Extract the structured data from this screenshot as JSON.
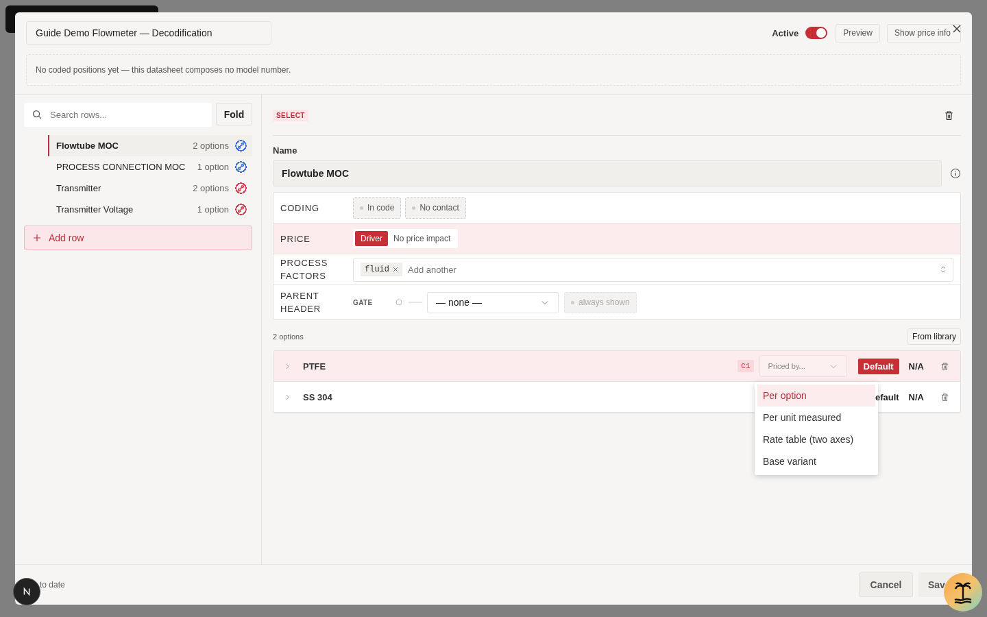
{
  "header": {
    "title": "Guide Demo Flowmeter — Decodification",
    "active": {
      "label": "Active",
      "on": true
    },
    "buttons": [
      "Preview",
      "Show price info"
    ]
  },
  "notice": "No coded positions yet — this datasheet composes no model number.",
  "sidebar": {
    "search": {
      "placeholder": "Search rows..."
    },
    "fold": "Fold",
    "rows": [
      {
        "name": "Flowtube MOC",
        "count": "2 options",
        "selected": true,
        "color": "#3b6fd1"
      },
      {
        "name": "PROCESS CONNECTION MOC",
        "count": "1 option",
        "selected": false,
        "color": "#3b6fd1"
      },
      {
        "name": "Transmitter",
        "count": "2 options",
        "selected": false,
        "color": "#d04050"
      },
      {
        "name": "Transmitter Voltage",
        "count": "1 option",
        "selected": false,
        "color": "#d04050"
      }
    ],
    "add_row": "Add row"
  },
  "editor": {
    "type_badge": "SELECT",
    "name_label": "Name",
    "name_value": "Flowtube MOC",
    "coding": {
      "label": "CODING",
      "chips": [
        "In code",
        "No contact"
      ]
    },
    "price": {
      "label": "PRICE",
      "options": [
        {
          "label": "Driver",
          "selected": true
        },
        {
          "label": "No price impact",
          "selected": false
        }
      ]
    },
    "process_factors": {
      "label": "PROCESS FACTORS",
      "tags": [
        "fluid"
      ],
      "placeholder": "Add another"
    },
    "parent_header": {
      "label": "PARENT HEADER",
      "gate": "GATE",
      "select": "— none —",
      "chip": "always shown"
    },
    "options_count": "2 options",
    "from_library": "From library",
    "options": [
      {
        "name": "PTFE",
        "selected": true,
        "code": "C1",
        "priced_by": "Priced by...",
        "default": "Default",
        "is_default": true,
        "price": "N/A"
      },
      {
        "name": "SS 304",
        "selected": false,
        "default": "efault",
        "is_default": false,
        "price": "N/A"
      }
    ],
    "dropdown": [
      {
        "label": "Per option",
        "selected": true
      },
      {
        "label": "Per unit measured",
        "selected": false
      },
      {
        "label": "Rate table (two axes)",
        "selected": false
      },
      {
        "label": "Base variant",
        "selected": false
      }
    ]
  },
  "footer": {
    "status": "to date",
    "cancel": "Cancel",
    "save": "Sav"
  }
}
